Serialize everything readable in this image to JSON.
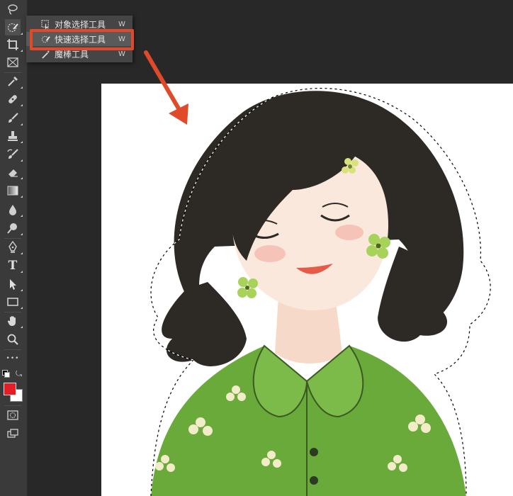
{
  "toolbar": {
    "tools": [
      {
        "name": "lasso-tool",
        "icon": "lasso-icon"
      },
      {
        "name": "quick-selection-tool",
        "icon": "quick-selection-icon",
        "active": true
      },
      {
        "name": "crop-tool",
        "icon": "crop-icon"
      },
      {
        "name": "frame-tool",
        "icon": "frame-icon"
      },
      {
        "name": "eyedropper-tool",
        "icon": "eyedropper-icon"
      },
      {
        "name": "healing-brush-tool",
        "icon": "bandage-icon"
      },
      {
        "name": "brush-tool",
        "icon": "brush-icon"
      },
      {
        "name": "clone-stamp-tool",
        "icon": "stamp-icon"
      },
      {
        "name": "history-brush-tool",
        "icon": "history-brush-icon"
      },
      {
        "name": "eraser-tool",
        "icon": "eraser-icon"
      },
      {
        "name": "gradient-tool",
        "icon": "gradient-icon"
      },
      {
        "name": "blur-tool",
        "icon": "drop-icon"
      },
      {
        "name": "dodge-tool",
        "icon": "dodge-icon"
      },
      {
        "name": "pen-tool",
        "icon": "pen-icon"
      },
      {
        "name": "type-tool",
        "icon": "type-icon"
      },
      {
        "name": "path-selection-tool",
        "icon": "arrow-icon"
      },
      {
        "name": "rectangle-tool",
        "icon": "rectangle-icon"
      },
      {
        "name": "hand-tool",
        "icon": "hand-icon"
      },
      {
        "name": "zoom-tool",
        "icon": "zoom-icon"
      },
      {
        "name": "more-tools",
        "icon": "ellipsis-icon"
      }
    ],
    "type_glyph": "T",
    "more_glyph": "•••",
    "foreground_color": "#e31e24",
    "background_color": "#ffffff"
  },
  "flyout": {
    "items": [
      {
        "label": "对象选择工具",
        "shortcut": "W",
        "icon": "object-selection-icon"
      },
      {
        "label": "快速选择工具",
        "shortcut": "W",
        "icon": "quick-selection-icon",
        "highlighted": true
      },
      {
        "label": "魔棒工具",
        "shortcut": "W",
        "icon": "magic-wand-icon"
      }
    ]
  },
  "annotation": {
    "color": "#e04a2b"
  },
  "canvas": {
    "background": "#ffffff",
    "content": "illustration of smiling girl with dark wavy hair, green floral shirt, with marching-ants selection"
  }
}
